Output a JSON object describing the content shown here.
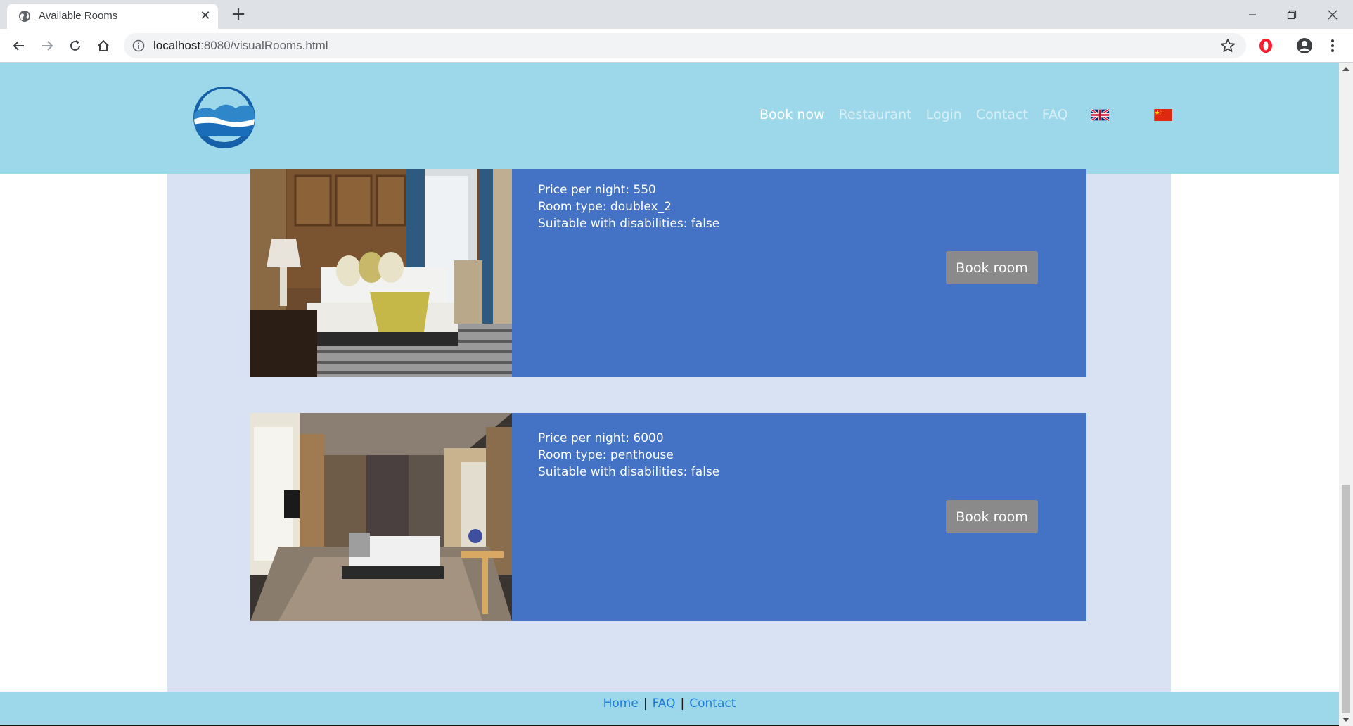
{
  "browser": {
    "tab_title": "Available Rooms",
    "url_host": "localhost",
    "url_rest": ":8080/visualRooms.html"
  },
  "header": {
    "nav": [
      "Book now",
      "Restaurant",
      "Login",
      "Contact",
      "FAQ"
    ],
    "active_item": "Book now",
    "flags": [
      "uk-flag-icon",
      "china-flag-icon"
    ]
  },
  "rooms": [
    {
      "price": "Price per night: 550",
      "type": "Room type: doublex_2",
      "disabled": "Suitable with disabilities: false",
      "button": "Book room"
    },
    {
      "price": "Price per night: 6000",
      "type": "Room type: penthouse",
      "disabled": "Suitable with disabilities: false",
      "button": "Book room"
    }
  ],
  "footer": {
    "links": [
      "Home",
      "FAQ",
      "Contact"
    ],
    "separator": "|"
  },
  "colors": {
    "header_bg": "#9dd8ea",
    "content_bg": "#d9e2f3",
    "card_bg": "#4472c4",
    "button_bg": "#8a8a8a",
    "footer_link": "#1e7bd6"
  }
}
